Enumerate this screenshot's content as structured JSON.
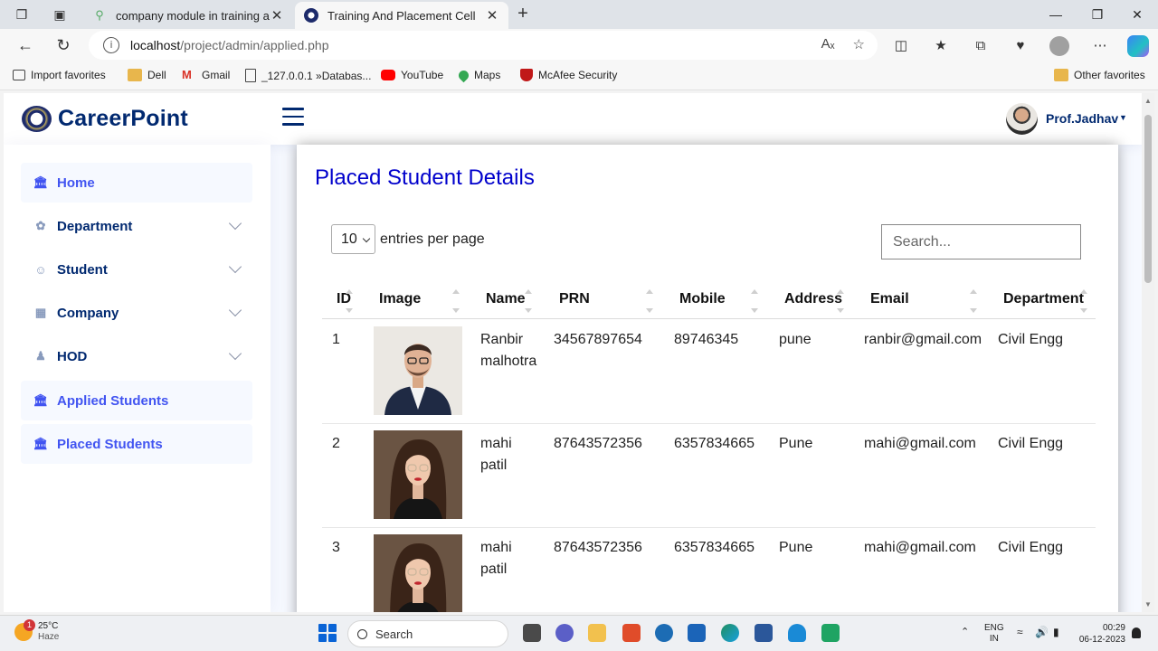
{
  "browser": {
    "tabs": [
      {
        "title": "company module in training and",
        "active": false
      },
      {
        "title": "Training And Placement Cell",
        "active": true
      }
    ],
    "url_host": "localhost",
    "url_path": "/project/admin/applied.php",
    "favorites": [
      "Import favorites",
      "Dell",
      "Gmail",
      "_127.0.0.1 »Databas...",
      "YouTube",
      "Maps",
      "McAfee Security"
    ],
    "other_favorites": "Other favorites"
  },
  "header": {
    "logo_text": "CareerPoint",
    "user_name": "Prof.Jadhav"
  },
  "sidebar": {
    "items": [
      {
        "label": "Home",
        "icon": "bank-icon",
        "expandable": false,
        "highlighted": true
      },
      {
        "label": "Department",
        "icon": "grid-icon",
        "expandable": true,
        "highlighted": false
      },
      {
        "label": "Student",
        "icon": "person-lines-icon",
        "expandable": true,
        "highlighted": false
      },
      {
        "label": "Company",
        "icon": "layout-icon",
        "expandable": true,
        "highlighted": false
      },
      {
        "label": "HOD",
        "icon": "people-icon",
        "expandable": true,
        "highlighted": false
      },
      {
        "label": "Applied Students",
        "icon": "bank-icon",
        "expandable": false,
        "highlighted": true
      },
      {
        "label": "Placed Students",
        "icon": "bank-icon",
        "expandable": false,
        "highlighted": true
      }
    ]
  },
  "main": {
    "title": "Placed Student Details",
    "entries_value": "10",
    "entries_label": "entries per page",
    "search_placeholder": "Search...",
    "columns": [
      "ID",
      "Image",
      "Name",
      "PRN",
      "Mobile",
      "Address",
      "Email",
      "Department"
    ],
    "rows": [
      {
        "id": "1",
        "name_line1": "Ranbir",
        "name_line2": "malhotra",
        "prn": "34567897654",
        "mobile": "89746345",
        "address": "pune",
        "email": "ranbir@gmail.com",
        "department": "Civil Engg",
        "photo": "man"
      },
      {
        "id": "2",
        "name_line1": "mahi",
        "name_line2": "patil",
        "prn": "87643572356",
        "mobile": "6357834665",
        "address": "Pune",
        "email": "mahi@gmail.com",
        "department": "Civil Engg",
        "photo": "woman"
      },
      {
        "id": "3",
        "name_line1": "mahi",
        "name_line2": "patil",
        "prn": "87643572356",
        "mobile": "6357834665",
        "address": "Pune",
        "email": "mahi@gmail.com",
        "department": "Civil Engg",
        "photo": "woman"
      }
    ]
  },
  "taskbar": {
    "temperature": "25°C",
    "weather": "Haze",
    "weather_badge": "1",
    "search_label": "Search",
    "lang_line1": "ENG",
    "lang_line2": "IN",
    "time": "00:29",
    "date": "06-12-2023"
  }
}
